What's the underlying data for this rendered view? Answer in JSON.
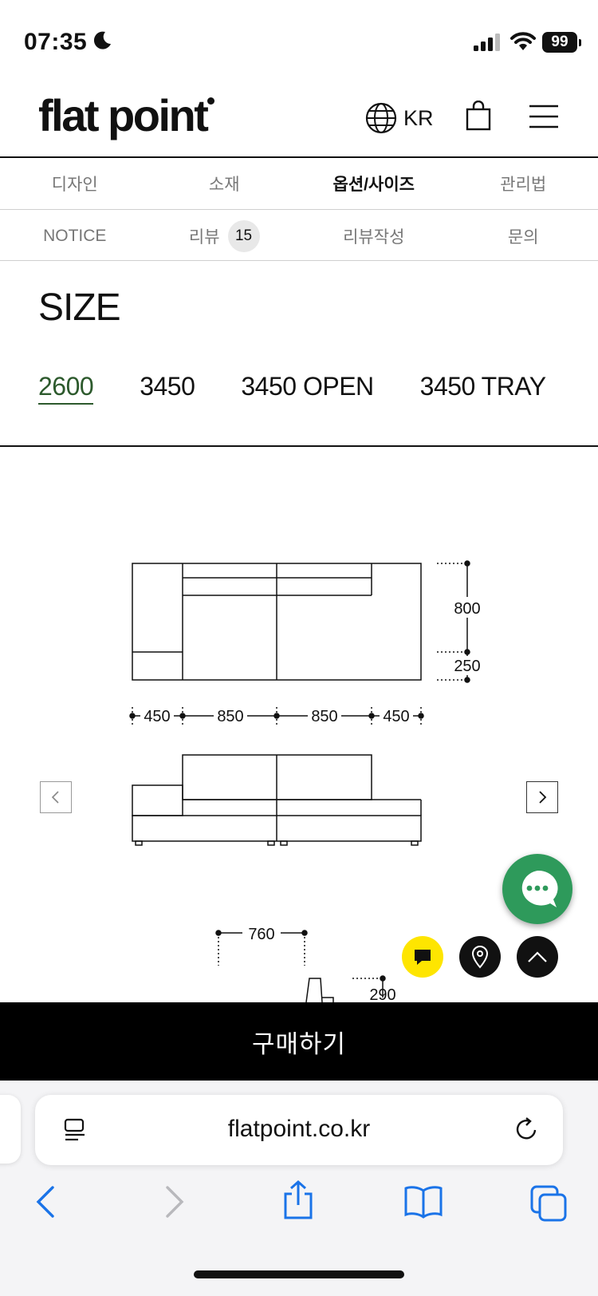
{
  "status": {
    "time": "07:35",
    "battery": "99"
  },
  "header": {
    "brand": "flat point",
    "lang": "KR"
  },
  "tabs_primary": [
    {
      "label": "디자인",
      "active": false
    },
    {
      "label": "소재",
      "active": false
    },
    {
      "label": "옵션/사이즈",
      "active": true
    },
    {
      "label": "관리법",
      "active": false
    }
  ],
  "tabs_secondary": [
    {
      "label": "NOTICE"
    },
    {
      "label": "리뷰",
      "badge": "15"
    },
    {
      "label": "리뷰작성"
    },
    {
      "label": "문의"
    }
  ],
  "size": {
    "title": "SIZE",
    "options": [
      "2600",
      "3450",
      "3450 OPEN",
      "3450 TRAY"
    ],
    "selected": "2600"
  },
  "drawing": {
    "depth_total": "800",
    "depth_base": "250",
    "widths": [
      "450",
      "850",
      "850",
      "450"
    ],
    "side_depth": "760",
    "side_height": "290"
  },
  "buy_label": "구매하기",
  "browser": {
    "url": "flatpoint.co.kr"
  },
  "colors": {
    "accent_green": "#2d5a2d",
    "chat_green": "#2e9a5b",
    "kakao_yellow": "#fee500"
  }
}
